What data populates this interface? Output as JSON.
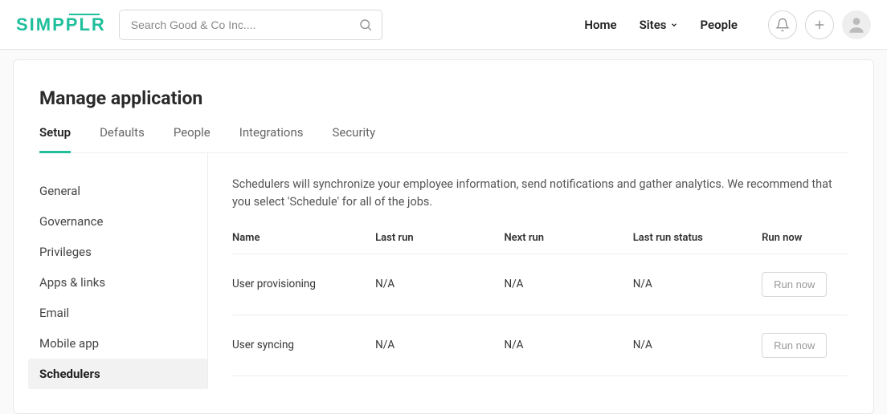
{
  "brand": "SIMPPLR",
  "search": {
    "placeholder": "Search Good & Co Inc...."
  },
  "topnav": {
    "home": "Home",
    "sites": "Sites",
    "people": "People"
  },
  "page": {
    "title": "Manage application",
    "tabs": [
      {
        "key": "setup",
        "label": "Setup",
        "active": true
      },
      {
        "key": "defaults",
        "label": "Defaults",
        "active": false
      },
      {
        "key": "people",
        "label": "People",
        "active": false
      },
      {
        "key": "integrations",
        "label": "Integrations",
        "active": false
      },
      {
        "key": "security",
        "label": "Security",
        "active": false
      }
    ],
    "sidenav": [
      {
        "key": "general",
        "label": "General",
        "active": false
      },
      {
        "key": "governance",
        "label": "Governance",
        "active": false
      },
      {
        "key": "privileges",
        "label": "Privileges",
        "active": false
      },
      {
        "key": "apps-links",
        "label": "Apps & links",
        "active": false
      },
      {
        "key": "email",
        "label": "Email",
        "active": false
      },
      {
        "key": "mobile-app",
        "label": "Mobile app",
        "active": false
      },
      {
        "key": "schedulers",
        "label": "Schedulers",
        "active": true
      }
    ],
    "intro": "Schedulers will synchronize your employee information, send notifications and gather analytics. We recommend that you select 'Schedule' for all of the jobs.",
    "table": {
      "headers": {
        "name": "Name",
        "last_run": "Last run",
        "next_run": "Next run",
        "last_run_status": "Last run status",
        "run_now": "Run now"
      },
      "rows": [
        {
          "name": "User provisioning",
          "last_run": "N/A",
          "next_run": "N/A",
          "status": "N/A",
          "action": "Run now"
        },
        {
          "name": "User syncing",
          "last_run": "N/A",
          "next_run": "N/A",
          "status": "N/A",
          "action": "Run now"
        }
      ]
    }
  }
}
